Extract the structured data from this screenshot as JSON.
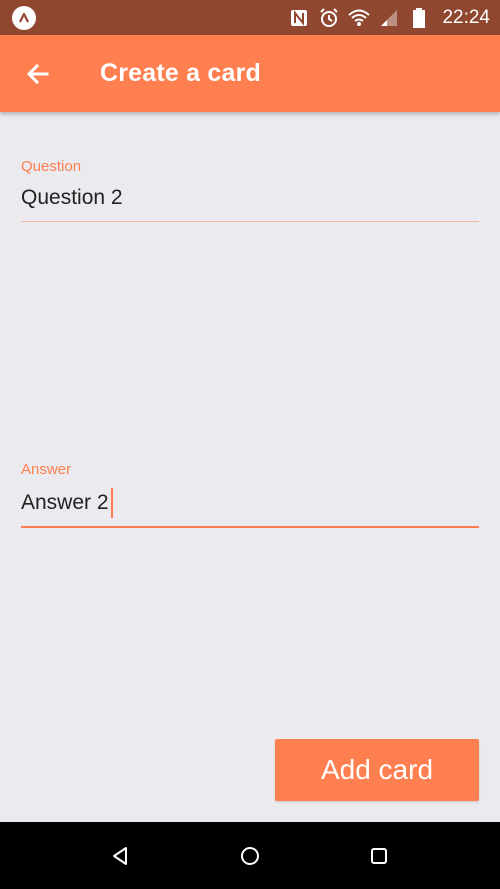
{
  "status_bar": {
    "time": "22:24",
    "icons": [
      "app-badge-icon",
      "nfc-icon",
      "alarm-icon",
      "wifi-icon",
      "signal-icon",
      "battery-icon"
    ],
    "background": "#8F4730"
  },
  "app_bar": {
    "title": "Create a card",
    "back_icon": "arrow-left-icon",
    "background": "#FF7F50"
  },
  "form": {
    "question": {
      "label": "Question",
      "value": "Question 2"
    },
    "answer": {
      "label": "Answer",
      "value": "Answer 2"
    },
    "accent": "#FF7F50"
  },
  "actions": {
    "add_card_label": "Add card"
  },
  "nav_bar": {
    "buttons": [
      "back-triangle-icon",
      "home-circle-icon",
      "recents-square-icon"
    ]
  }
}
